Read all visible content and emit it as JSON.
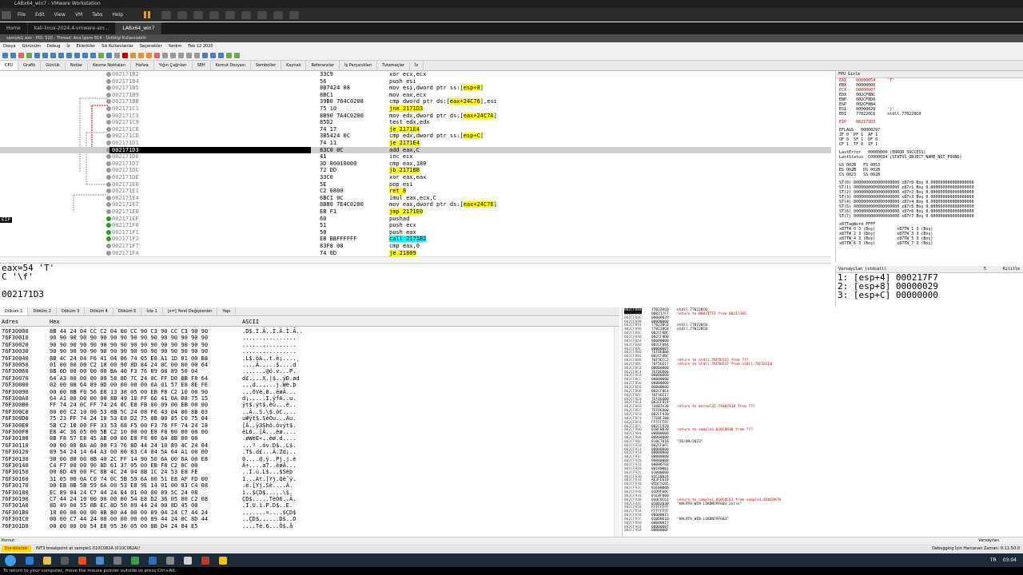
{
  "vmware": {
    "title": "LABx64_win7 - VMware Workstation",
    "menu": [
      "File",
      "Edit",
      "View",
      "VM",
      "Tabs",
      "Help"
    ],
    "tabs": [
      "Home",
      "kali-linux-2024.4-vmware-am...",
      "LABx64_win7"
    ],
    "hint": "To return to your computer, move the mouse pointer outside or press Ctrl+Alt."
  },
  "x64dbg": {
    "title": "sample1.exe - PID: 520 - Thread: Ana İşlem 814 - Üstbilgi Kullanılabilir",
    "menu": [
      "Dosya",
      "Görünüm",
      "Debug",
      "İz",
      "Eklentiler",
      "Sık Kullanılanlar",
      "Seçenekler",
      "Yardım",
      "Feb 12 2020"
    ],
    "tabs": [
      "CPU",
      "Grafik",
      "Günlük",
      "Notlar",
      "Kesme Noktaları",
      "Hafıza",
      "Yığın Çağrıları",
      "SEH",
      "Komut Dosyası",
      "Semboller",
      "Kaynak",
      "Referanslar",
      "İş Parçacıkları",
      "Tutamaçlar",
      "İz"
    ]
  },
  "cpu": {
    "eip_label": "EIP",
    "rows": [
      {
        "addr": "002171B2",
        "bytes": "33C9",
        "instr": "xor ecx,ecx",
        "bp": "",
        "hl": ""
      },
      {
        "addr": "002171B4",
        "bytes": "56",
        "instr": "push esi",
        "bp": "",
        "hl": ""
      },
      {
        "addr": "002171B5",
        "bytes": "8B7424 08",
        "instr": "mov esi,dword ptr ss:[esp+8]",
        "bp": "",
        "hl": "seg"
      },
      {
        "addr": "002171B9",
        "bytes": "8BC1",
        "instr": "mov eax,ecx",
        "bp": "",
        "hl": ""
      },
      {
        "addr": "002171BB",
        "bytes": "39B0 764C0200",
        "instr": "cmp dword ptr ds:[eax+24C76],esi",
        "bp": "",
        "hl": "seg"
      },
      {
        "addr": "002171C1",
        "bytes": "75 10",
        "instr": "jne 2171D3",
        "bp": "",
        "hl": "jmp"
      },
      {
        "addr": "002171C3",
        "bytes": "8B90 7A4C0200",
        "instr": "mov edx,dword ptr ds:[eax+24C7A]",
        "bp": "",
        "hl": "seg"
      },
      {
        "addr": "002171C9",
        "bytes": "85D2",
        "instr": "test edx,edx",
        "bp": "",
        "hl": ""
      },
      {
        "addr": "002171CB",
        "bytes": "74 17",
        "instr": "je 2171E4",
        "bp": "",
        "hl": "jmp"
      },
      {
        "addr": "002171CD",
        "bytes": "3B5424 0C",
        "instr": "cmp edx,dword ptr ss:[esp+C]",
        "bp": "",
        "hl": "seg"
      },
      {
        "addr": "002171D1",
        "bytes": "74 11",
        "instr": "je 2171E4",
        "bp": "",
        "hl": "jmp"
      },
      {
        "addr": "002171D3",
        "bytes": "83C0 0C",
        "instr": "add eax,C",
        "bp": "",
        "hl": "cur"
      },
      {
        "addr": "002171D6",
        "bytes": "41",
        "instr": "inc ecx",
        "bp": "",
        "hl": ""
      },
      {
        "addr": "002171D7",
        "bytes": "3D 80010000",
        "instr": "cmp eax,180",
        "bp": "",
        "hl": ""
      },
      {
        "addr": "002171DC",
        "bytes": "72 DD",
        "instr": "jb 2171BB",
        "bp": "",
        "hl": "jmp"
      },
      {
        "addr": "002171DE",
        "bytes": "33C0",
        "instr": "xor eax,eax",
        "bp": "",
        "hl": ""
      },
      {
        "addr": "002171E0",
        "bytes": "5E",
        "instr": "pop esi",
        "bp": "",
        "hl": ""
      },
      {
        "addr": "002171E1",
        "bytes": "C2 0800",
        "instr": "ret 8",
        "bp": "",
        "hl": "ret"
      },
      {
        "addr": "002171E4",
        "bytes": "6BC1 0C",
        "instr": "imul eax,ecx,C",
        "bp": "",
        "hl": ""
      },
      {
        "addr": "002171E7",
        "bytes": "8B80 7E4C0200",
        "instr": "mov eax,dword ptr ds:[eax+24C7E]",
        "bp": "",
        "hl": "seg"
      },
      {
        "addr": "002171ED",
        "bytes": "EB F1",
        "instr": "jmp 2171E0",
        "bp": "",
        "hl": "jmp"
      },
      {
        "addr": "002171EF",
        "bytes": "60",
        "instr": "pushad",
        "bp": "g",
        "hl": ""
      },
      {
        "addr": "002171F0",
        "bytes": "51",
        "instr": "push ecx",
        "bp": "g",
        "hl": ""
      },
      {
        "addr": "002171F1",
        "bytes": "50",
        "instr": "push eax",
        "bp": "g",
        "hl": ""
      },
      {
        "addr": "002171F2",
        "bytes": "E8 BBFFFFFF",
        "instr": "call 2171B2",
        "bp": "g",
        "hl": "call"
      },
      {
        "addr": "002171F7",
        "bytes": "83F8 00",
        "instr": "cmp eax,0",
        "bp": "",
        "hl": ""
      },
      {
        "addr": "002171FA",
        "bytes": "74 0D",
        "instr": "je 21809",
        "bp": "",
        "hl": "jmp"
      }
    ]
  },
  "registers": {
    "header": "FPU Gizle",
    "lines": [
      {
        "t": "EAX    00000054     'T'",
        "red": true
      },
      {
        "t": "EBX    00000000",
        "red": false
      },
      {
        "t": "ECX    00000007",
        "red": true
      },
      {
        "t": "EDX    002CF8BC",
        "red": false
      },
      {
        "t": "EBP    002CF8D0",
        "red": false
      },
      {
        "t": "ESP    002CF884",
        "red": false
      },
      {
        "t": "ESI    00000029     ')'",
        "red": false
      },
      {
        "t": "EDI    770220C0     ntdll.770220C0",
        "red": false
      },
      {
        "t": "",
        "red": false
      },
      {
        "t": "EIP    002171D3",
        "red": true
      },
      {
        "t": "",
        "red": false
      },
      {
        "t": "EFLAGS   00000297",
        "red": false
      },
      {
        "t": "ZF 0  PF 1  AF 1",
        "red": false
      },
      {
        "t": "OF 0  SF 1  DF 0",
        "red": false
      },
      {
        "t": "CF 1  TF 0  IF 1",
        "red": false
      },
      {
        "t": "",
        "red": false
      },
      {
        "t": "LastError   00000000 (ERROR_SUCCESS)",
        "red": false
      },
      {
        "t": "LastStatus  C0000034 (STATUS_OBJECT_NAME_NOT_FOUND)",
        "red": false
      },
      {
        "t": "",
        "red": false
      },
      {
        "t": "GS 002B   FS 0053",
        "red": false
      },
      {
        "t": "ES 002B   DS 002B",
        "red": false
      },
      {
        "t": "CS 0023   SS 002B",
        "red": false
      },
      {
        "t": "",
        "red": false
      },
      {
        "t": "ST(0) 0000000000000000000 x87r0 Boş 0.000000000000000000",
        "red": false
      },
      {
        "t": "ST(1) 0000000000000000000 x87r1 Boş 0.000000000000000000",
        "red": false
      },
      {
        "t": "ST(2) 0000000000000000000 x87r2 Boş 0.000000000000000000",
        "red": false
      },
      {
        "t": "ST(3) 0000000000000000000 x87r3 Boş 0.000000000000000000",
        "red": false
      },
      {
        "t": "ST(4) 0000000000000000000 x87r4 Boş 0.000000000000000000",
        "red": false
      },
      {
        "t": "ST(5) 0000000000000000000 x87r5 Boş 0.000000000000000000",
        "red": false
      },
      {
        "t": "ST(6) 0000000000000000000 x87r6 Boş 0.000000000000000000",
        "red": false
      },
      {
        "t": "ST(7) 0000000000000000000 x87r7 Boş 0.000000000000000000",
        "red": false
      },
      {
        "t": "",
        "red": false
      },
      {
        "t": "x87TagWord FFFF",
        "red": false
      },
      {
        "t": "x87TW_0 3 (Boş)         x87TW_1 3 (Boş)",
        "red": false
      },
      {
        "t": "x87TW_2 3 (Boş)         x87TW_3 3 (Boş)",
        "red": false
      },
      {
        "t": "x87TW_4 3 (Boş)         x87TW_5 3 (Boş)",
        "red": false
      },
      {
        "t": "x87TW_6 3 (Boş)         x87TW_7 3 (Boş)",
        "red": false
      }
    ]
  },
  "info": {
    "line1": "eax=54 'T'",
    "line2": "C '\\f'",
    "line3": "002171D3"
  },
  "args": {
    "conv": "Varsayılan (stdcall)",
    "count": "5",
    "lock": "Kilitle",
    "rows": [
      "1: [esp+4] 000217F7",
      "2: [esp+8] 00000029",
      "3: [esp+C] 00000000"
    ]
  },
  "dump": {
    "tabs": [
      "Döküm 1",
      "Döküm 2",
      "Döküm 3",
      "Döküm 4",
      "Döküm 5",
      "İzle 1",
      "[x=] Yerel Değişkenler",
      "Yapı"
    ],
    "col_addr": "Adres",
    "col_hex": "Hex",
    "col_ascii": "ASCII",
    "rows": [
      {
        "a": "76F30000",
        "h": "8B 44 24 04 CC C2 04 00 CC 90 C3 90 CC C3 90 90",
        "c": ".D$.Ì.Â..Ì.Ã.Ì.Ã.."
      },
      {
        "a": "76F30010",
        "h": "90 90 90 90 90 90 90 90 90 90 90 90 90 90 90 90",
        "c": "................"
      },
      {
        "a": "76F30020",
        "h": "90 90 90 90 90 90 90 90 90 90 90 90 90 90 90 90",
        "c": "................"
      },
      {
        "a": "76F30030",
        "h": "90 90 90 90 90 90 90 90 90 90 90 90 90 90 90 90",
        "c": "................"
      },
      {
        "a": "76F30040",
        "h": "8B 4C 24 04 F6 41 04 06 74 05 E8 A1 1D 01 00 B8",
        "c": ".L$.öA..t.è¡....¸"
      },
      {
        "a": "76F30050",
        "h": "01 00 00 00 C2 10 00 90 8D 84 24 0C 00 00 00 64",
        "c": "....Â.....$....d"
      },
      {
        "a": "76F30060",
        "h": "8B 0D 00 00 00 00 BA 40 F3 76 89 08 89 50 04",
        "c": ".......@ó.v...P."
      },
      {
        "a": "76F30070",
        "h": "64 A3 00 00 00 00 58 8D 7C 24 0C FF D0 8B F8 64",
        "c": "d£....X.|$..ÿÐ.ød"
      },
      {
        "a": "76F30080",
        "h": "02 00 00 64 89 0D 00 00 00 00 6A 01 57 E8 8E FE",
        "c": "...d......j.Wè.þ"
      },
      {
        "a": "76F30090",
        "h": "00 00 8B F0 56 E8 13 38 05 00 EB F8 C2 10 00 90",
        "c": "...ðVè.8..ëøÂ..."
      },
      {
        "a": "76F300A0",
        "h": "64 A1 00 00 00 00 8B 49 10 FF 66 41 0A 08 75 15",
        "c": "d¡.....I.ÿfA..u."
      },
      {
        "a": "76F300B0",
        "h": "FF 74 24 0C FF 74 24 0C E8 FB 00 09 00 EB 00 00",
        "c": "ÿt$.ÿt$.èû...ë.."
      },
      {
        "a": "76F300C0",
        "h": "00 00 C2 10 00 53 8B 5C 24 08 F6 43 04 06 8B 03",
        "c": "..Â..S.\\$.öC...."
      },
      {
        "a": "76F300D0",
        "h": "75 23 FF 74 24 10 53 E8 D2 75 0B 00 85 C0 75 04",
        "c": "u#ÿt$.SèÒu...Àu."
      },
      {
        "a": "76F300E0",
        "h": "5B C2 10 00 FF 33 53 68 F5 00 F3 76 FF 74 24 18",
        "c": "[Â..ÿ3Shõ.óvÿt$."
      },
      {
        "a": "76F300F0",
        "h": "E8 4C 36 05 00 5B C2 10 00 00 E8 F8 00 00 00 00",
        "c": "èL6..[Â...èø...."
      },
      {
        "a": "76F30100",
        "h": "8B F8 57 E8 45 AB 00 00 E8 F8 00 64 8B 00 00",
        "c": ".øWèE«..èø.d...."
      },
      {
        "a": "76F30110",
        "h": "00 00 00 BA A0 00 F3 76 8D 44 24 10 89 4C 24 04",
        "c": "...º .óv.D$..L$."
      },
      {
        "a": "76F30120",
        "h": "89 54 24 14 64 A3 00 00 83 C4 04 5A 64 A1 00 00",
        "c": ".T$.d£...Ä.Zd¡.."
      },
      {
        "a": "76F30130",
        "h": "30 00 00 00 8B 40 2C FF 14 90 50 6A 00 6A 00 E8",
        "c": "0....@,ÿ..Pj.j.è"
      },
      {
        "a": "76F30140",
        "h": "C4 F7 00 00 90 8D 61 37 05 00 EB F8 C2 0C 00",
        "c": "Ä÷....a7..ëøÂ..."
      },
      {
        "a": "76F30150",
        "h": "00 8D 49 00 FC 8B 4C 24 04 8B 1C 24 53 E8 FE",
        "c": "..I.ü.L$...$Sèþ"
      },
      {
        "a": "76F30160",
        "h": "31 05 00 0A C0 74 0C 5B 59 6A 00 51 E8 AF FD 00",
        "c": "1...Àt.[Yj.Qè¯ý."
      },
      {
        "a": "76F30170",
        "h": "00 EB 0B 5B 59 6A 00 53 E8 9E 14 01 00 83 C4 08",
        "c": ".ë.[Yj.Sè....Ä."
      },
      {
        "a": "76F30180",
        "h": "EC 89 04 24 C7 44 24 04 01 00 00 89 5C 24 08",
        "c": "ì..$ÇD$.....\\$."
      },
      {
        "a": "76F30190",
        "h": "C7 44 24 10 00 00 00 00 54 E8 D2 36 05 00 C2 08",
        "c": "ÇD$.....TèÒ6..Â."
      },
      {
        "a": "76F301A0",
        "h": "8D 49 00 55 8B EC 8D 50 89 44 24 00 8D 45 08",
        "c": ".I.U.ì.P.D$..E."
      },
      {
        "a": "76F301B0",
        "h": "18 00 00 00 00 8B 80 A4 00 00 89 04 24 C7 44 24",
        "c": ".......¤....$ÇD$"
      },
      {
        "a": "76F301C0",
        "h": "00 00 C7 44 24 08 00 00 00 00 89 44 24 0C 8D 44",
        "c": "..ÇD$......D$..D"
      },
      {
        "a": "76F301D0",
        "h": "00 00 00 00 54 E8 95 36 05 00 8B D4 24 84 E5",
        "c": "....Tè.6...Ô$.å"
      }
    ]
  },
  "stack": {
    "rows": [
      {
        "a": "002CF884",
        "v": "770220C0",
        "c": "ntdll.770220C0",
        "k": true,
        "top": true
      },
      {
        "a": "002CF888",
        "v": "000217F7",
        "c": "return to 000217F7 from 002171B2",
        "k": false
      },
      {
        "a": "002CF88C",
        "v": "00000029",
        "c": "",
        "k": true
      },
      {
        "a": "002CF890",
        "v": "00000000",
        "c": "",
        "k": true
      },
      {
        "a": "002CF894",
        "v": "770220C0",
        "c": "ntdll.770220C0",
        "k": true
      },
      {
        "a": "002CF898",
        "v": "770220C0",
        "c": "ntdll.770220C0",
        "k": true
      },
      {
        "a": "002CF89C",
        "v": "002CF8BC",
        "c": "",
        "k": true
      },
      {
        "a": "002CF8A0",
        "v": "002CF8D0",
        "c": "",
        "k": true
      },
      {
        "a": "002CF8A4",
        "v": "00000000",
        "c": "",
        "k": true
      },
      {
        "a": "002CF8A8",
        "v": "002CF884",
        "c": "",
        "k": true
      },
      {
        "a": "002CF8AC",
        "v": "00000007",
        "c": "",
        "k": true
      },
      {
        "a": "002CF8B0",
        "v": "7EFDE000",
        "c": "",
        "k": true
      },
      {
        "a": "002CF8B4",
        "v": "002CF8BC",
        "c": "",
        "k": true
      },
      {
        "a": "002CF8B8",
        "v": "76F5ECC2",
        "c": "return to ntdll.76F5ECC2 from ???",
        "k": false
      },
      {
        "a": "002CF8BC",
        "v": "76F5EE17",
        "c": "return to ntdll.76F5EE17 from ntdll.76F5ECE0",
        "k": false
      },
      {
        "a": "002CF8C0",
        "v": "00000000",
        "c": "",
        "k": true
      },
      {
        "a": "002CF8C4",
        "v": "7EFDE000",
        "c": "",
        "k": true
      },
      {
        "a": "002CF8C8",
        "v": "00000000",
        "c": "",
        "k": true
      },
      {
        "a": "002CF8CC",
        "v": "00000000",
        "c": "",
        "k": true
      },
      {
        "a": "002CF8D0",
        "v": "00000000",
        "c": "",
        "k": true
      },
      {
        "a": "002CF8D4",
        "v": "00000000",
        "c": "",
        "k": true
      },
      {
        "a": "002CF8D8",
        "v": "002CF8E4",
        "c": "",
        "k": true
      },
      {
        "a": "002CF8DC",
        "v": "76F5EE17",
        "c": "",
        "k": true
      },
      {
        "a": "002CF8E0",
        "v": "7EFDE000",
        "c": "",
        "k": true
      },
      {
        "a": "002CF8E4",
        "v": "002CF924",
        "c": "",
        "k": true
      },
      {
        "a": "002CF8E8",
        "v": "74007A30",
        "c": "return to kernel32.74007A30 from ???",
        "k": false
      },
      {
        "a": "002CF8EC",
        "v": "7EFDE000",
        "c": "",
        "k": true
      },
      {
        "a": "002CF8F0",
        "v": "002CF930",
        "c": "",
        "k": true
      },
      {
        "a": "002CF8F4",
        "v": "77EBF380",
        "c": "",
        "k": true
      },
      {
        "a": "002CF8F8",
        "v": "FFFFFFFF",
        "c": "",
        "k": true
      },
      {
        "a": "002CF8FC",
        "v": "002CF920",
        "c": "",
        "k": true
      },
      {
        "a": "002CF900",
        "v": "010C0830",
        "c": "return to sample1.010C0830 from ???",
        "k": false
      },
      {
        "a": "002CF904",
        "v": "00000000",
        "c": "",
        "k": true
      },
      {
        "a": "002CF908",
        "v": "00000000",
        "c": "",
        "k": true
      },
      {
        "a": "002CF90C",
        "v": "010C7010",
        "c": "\"26/09/2023\"",
        "k": true
      },
      {
        "a": "002CF910",
        "v": "002CF8FC",
        "c": "",
        "k": true
      },
      {
        "a": "002CF914",
        "v": "00000000",
        "c": "",
        "k": true
      },
      {
        "a": "002CF918",
        "v": "00000000",
        "c": "",
        "k": true
      },
      {
        "a": "002CF91C",
        "v": "00000000",
        "c": "",
        "k": true
      },
      {
        "a": "002CF920",
        "v": "00000000",
        "c": "",
        "k": true
      },
      {
        "a": "002CF924",
        "v": "00B067E8",
        "c": "",
        "k": true
      },
      {
        "a": "002CF928",
        "v": "00180001",
        "c": "",
        "k": true
      },
      {
        "a": "002CF92C",
        "v": "01000000",
        "c": "",
        "k": true
      },
      {
        "a": "002CF930",
        "v": "01C10024",
        "c": "",
        "k": true
      },
      {
        "a": "002CF934",
        "v": "AE3FE610",
        "c": "",
        "k": true
      },
      {
        "a": "002CF938",
        "v": "05DC5C05",
        "c": "",
        "k": true
      },
      {
        "a": "002CF93C",
        "v": "01E00000",
        "c": "",
        "k": true
      },
      {
        "a": "002CF940",
        "v": "01D9F00C",
        "c": "",
        "k": true
      },
      {
        "a": "002CF944",
        "v": "01E8F000",
        "c": "",
        "k": true
      },
      {
        "a": "002CF948",
        "v": "010C0C61",
        "c": "return to sample1.010C0C61 from sample1.010C0A70",
        "k": false
      },
      {
        "a": "002CF94C",
        "v": "010D2030",
        "c": "\"HAL9TH_WIN-L1KDN79F603_2orro\"",
        "k": true
      },
      {
        "a": "002CF950",
        "v": "FFFFFFFF",
        "c": "",
        "k": true
      },
      {
        "a": "002CF954",
        "v": "FFFFFFFF",
        "c": "",
        "k": true
      },
      {
        "a": "002CF958",
        "v": "00000015",
        "c": "",
        "k": true
      },
      {
        "a": "002CF95C",
        "v": "010D0010",
        "c": "\"HAL9TH_WIN-L1KDN79F603\"",
        "k": true
      },
      {
        "a": "002CF960",
        "v": "00000017",
        "c": "",
        "k": true
      },
      {
        "a": "002CF964",
        "v": "00000007",
        "c": "",
        "k": true
      },
      {
        "a": "002CF968",
        "v": "0000000F",
        "c": "",
        "k": true
      }
    ]
  },
  "command": {
    "label": "Komut:",
    "default": "Varsayılan"
  },
  "status": {
    "paused": "Duraklatıldı",
    "msg": "INT3 breakpoint at sample1.010C082A (010C082A)!",
    "time": "Debugging İçin Harcanan Zaman: 0:11:50:0"
  },
  "taskbar": {
    "lang": "TR",
    "clock": "03:04"
  }
}
